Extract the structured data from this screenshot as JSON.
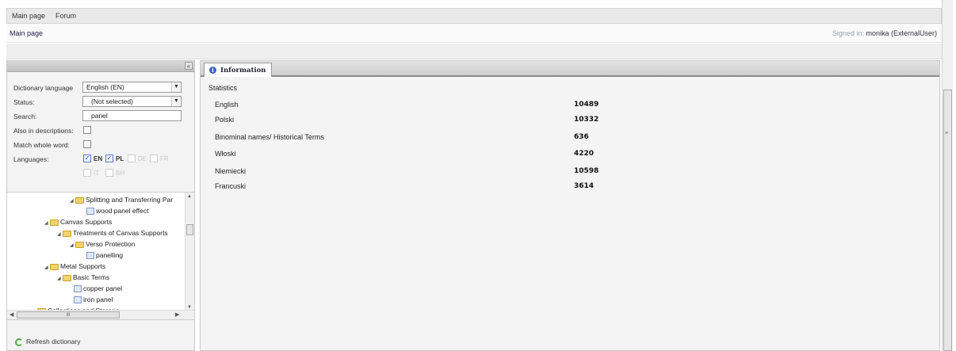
{
  "topmenu": {
    "items": [
      "Main page",
      "Forum"
    ]
  },
  "titlebar": {
    "crumb": "Main page",
    "signed_prefix": "Signed in:",
    "signed_user": "monika (ExternalUser)"
  },
  "leftpanel": {
    "collapse_icon": "«",
    "form": {
      "dict_lang_label": "Dictionary language",
      "dict_lang_value": "English (EN)",
      "status_label": "Status:",
      "status_value": "(Not selected)",
      "search_label": "Search:",
      "search_value": "panel",
      "also_desc_label": "Also in descriptions:",
      "match_whole_label": "Match whole word:",
      "languages_label": "Languages:",
      "languages": [
        {
          "code": "EN",
          "checked": true
        },
        {
          "code": "PL",
          "checked": true
        },
        {
          "code": "DE",
          "checked": false
        },
        {
          "code": "FR",
          "checked": false
        },
        {
          "code": "IT",
          "checked": false
        },
        {
          "code": "BH",
          "checked": false
        }
      ]
    },
    "tree": [
      {
        "label": "Splitting and Transferring Par",
        "type": "folder"
      },
      {
        "label": "wood panel effect",
        "type": "doc"
      },
      {
        "label": "Canvas Supports",
        "type": "folder"
      },
      {
        "label": "Treatments of Canvas Supports",
        "type": "folder"
      },
      {
        "label": "Verso Protection",
        "type": "folder"
      },
      {
        "label": "panelling",
        "type": "doc"
      },
      {
        "label": "Metal Supports",
        "type": "folder"
      },
      {
        "label": "Basic Terms",
        "type": "folder"
      },
      {
        "label": "copper panel",
        "type": "doc"
      },
      {
        "label": "iron panel",
        "type": "doc"
      },
      {
        "label": "Collections and Storage",
        "type": "folder"
      }
    ],
    "hscroll_grip": "III",
    "refresh_label": "Refresh dictionary"
  },
  "rightpanel": {
    "tab_label": "Information",
    "stats_title": "Statistics",
    "stats": [
      {
        "name": "English",
        "value": "10489"
      },
      {
        "name": "Polski",
        "value": "10332"
      },
      {
        "name": "Binominal names/ Historical Terms",
        "value": "636"
      },
      {
        "name": "Włoski",
        "value": "4220"
      },
      {
        "name": "Niemiecki",
        "value": "10598"
      },
      {
        "name": "Francuski",
        "value": "3614"
      }
    ]
  }
}
